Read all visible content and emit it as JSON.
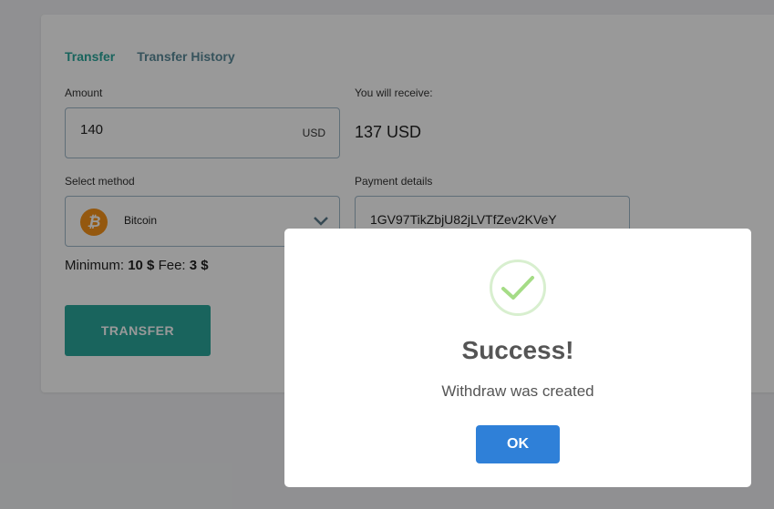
{
  "tabs": [
    {
      "label": "Transfer"
    },
    {
      "label": "Transfer History"
    }
  ],
  "form": {
    "amount_label": "Amount",
    "amount_value": "140",
    "amount_unit": "USD",
    "receive_label": "You will receive:",
    "receive_value": "137 USD",
    "method_label": "Select method",
    "method_selected": "Bitcoin",
    "method_icon": "bitcoin-icon",
    "details_label": "Payment details",
    "details_value": "1GV97TikZbjU82jLVTfZev2KVeY",
    "minimum_label": "Minimum:",
    "minimum_value": "10 $",
    "fee_label": "Fee:",
    "fee_value": "3 $",
    "transfer_button": "TRANSFER"
  },
  "modal": {
    "icon": "checkmark-icon",
    "title": "Success!",
    "message": "Withdraw was created",
    "ok_button": "OK"
  },
  "colors": {
    "accent": "#2aa79b",
    "ok_button": "#2f80d8",
    "bitcoin": "#f7931a",
    "success": "#a5dc86"
  }
}
